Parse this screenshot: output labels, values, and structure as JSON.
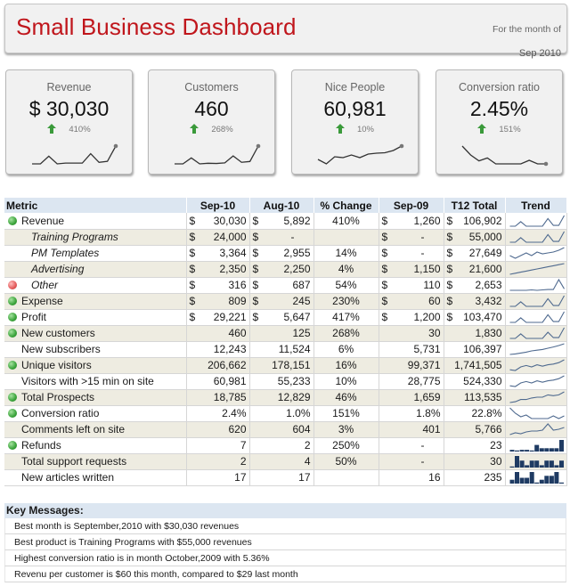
{
  "header": {
    "title": "Small Business Dashboard",
    "subtitle": "For the month of",
    "period": "Sep 2010"
  },
  "kpis": [
    {
      "label": "Revenue",
      "value": "$  30,030",
      "change": "410%",
      "direction": "up",
      "trend": [
        2,
        2,
        5,
        2,
        2.3,
        2.3,
        2.3,
        6,
        2.6,
        3,
        9
      ]
    },
    {
      "label": "Customers",
      "value": "460",
      "change": "268%",
      "direction": "up",
      "trend": [
        2,
        2,
        5,
        2,
        2.3,
        2.2,
        2.5,
        6,
        2.8,
        3.2,
        11
      ]
    },
    {
      "label": "Nice People",
      "value": "60,981",
      "change": "10%",
      "direction": "up",
      "trend": [
        3,
        2,
        3.6,
        3.4,
        4,
        3.4,
        4.2,
        4.4,
        4.5,
        5,
        6
      ]
    },
    {
      "label": "Conversion ratio",
      "value": "2.45%",
      "change": "151%",
      "direction": "up",
      "trend": [
        9,
        6,
        4,
        5,
        3,
        3,
        3,
        3,
        4.2,
        3,
        3
      ]
    }
  ],
  "table": {
    "headers": [
      "Metric",
      "Sep-10",
      "Aug-10",
      "% Change",
      "Sep-09",
      "T12 Total",
      "Trend"
    ],
    "rows": [
      {
        "metric": "Revenue",
        "indicator": "green",
        "sub": false,
        "currency": true,
        "sep10": "30,030",
        "aug10": "5,892",
        "change": "410%",
        "change_neg": false,
        "sep09": "1,260",
        "t12": "106,902",
        "trend_type": "line",
        "trend": [
          2,
          2,
          5,
          2,
          2,
          2,
          2,
          7,
          2.5,
          2.5,
          9
        ]
      },
      {
        "metric": "Training Programs",
        "indicator": "none",
        "sub": true,
        "currency": true,
        "sep10": "24,000",
        "aug10": "-",
        "change": "",
        "change_neg": false,
        "sep09": "-",
        "t12": "55,000",
        "trend_type": "line",
        "trend": [
          2,
          2,
          5,
          2,
          2,
          2,
          2,
          7,
          2.5,
          2.5,
          9
        ]
      },
      {
        "metric": "PM Templates",
        "indicator": "none",
        "sub": true,
        "currency": true,
        "sep10": "3,364",
        "aug10": "2,955",
        "change": "14%",
        "change_neg": false,
        "sep09": "-",
        "t12": "27,649",
        "trend_type": "line",
        "trend": [
          5,
          3.5,
          5,
          6.5,
          5,
          7,
          6,
          6.5,
          7,
          8,
          9.5
        ]
      },
      {
        "metric": "Advertising",
        "indicator": "none",
        "sub": true,
        "currency": true,
        "sep10": "2,350",
        "aug10": "2,250",
        "change": "4%",
        "change_neg": false,
        "sep09": "1,150",
        "t12": "21,600",
        "trend_type": "line",
        "trend": [
          3,
          3.5,
          4,
          4.5,
          5,
          5.5,
          6,
          6.5,
          7,
          7.5,
          8
        ]
      },
      {
        "metric": "Other",
        "indicator": "red",
        "sub": true,
        "currency": true,
        "sep10": "316",
        "aug10": "687",
        "change": "54%",
        "change_neg": true,
        "sep09": "110",
        "t12": "2,653",
        "trend_type": "line",
        "trend": [
          2,
          2,
          2,
          2,
          2.3,
          2,
          2.3,
          2.5,
          2.5,
          9,
          3
        ]
      },
      {
        "metric": "Expense",
        "indicator": "green",
        "sub": false,
        "currency": true,
        "sep10": "809",
        "aug10": "245",
        "change": "230%",
        "change_neg": false,
        "sep09": "60",
        "t12": "3,432",
        "trend_type": "line",
        "trend": [
          2,
          2,
          5,
          2,
          2,
          2,
          2,
          7,
          2.5,
          2.5,
          9
        ]
      },
      {
        "metric": "Profit",
        "indicator": "green",
        "sub": false,
        "currency": true,
        "sep10": "29,221",
        "aug10": "5,647",
        "change": "417%",
        "change_neg": false,
        "sep09": "1,200",
        "t12": "103,470",
        "trend_type": "line",
        "trend": [
          2,
          2,
          5,
          2,
          2,
          2,
          2,
          7,
          2.5,
          2.5,
          9
        ]
      },
      {
        "metric": "New customers",
        "indicator": "green",
        "sub": false,
        "currency": false,
        "sep10": "460",
        "aug10": "125",
        "change": "268%",
        "change_neg": false,
        "sep09": "30",
        "t12": "1,830",
        "trend_type": "line",
        "trend": [
          2,
          2,
          5,
          2,
          2,
          2,
          2,
          6,
          2.5,
          2.5,
          9
        ]
      },
      {
        "metric": "New subscribers",
        "indicator": "none",
        "sub": false,
        "currency": false,
        "sep10": "12,243",
        "aug10": "11,524",
        "change": "6%",
        "change_neg": false,
        "sep09": "5,731",
        "t12": "106,397",
        "trend_type": "line",
        "trend": [
          3,
          3.3,
          3.8,
          4.3,
          5,
          5.4,
          5.8,
          6.5,
          7.2,
          8,
          9
        ]
      },
      {
        "metric": "Unique visitors",
        "indicator": "green",
        "sub": false,
        "currency": false,
        "sep10": "206,662",
        "aug10": "178,151",
        "change": "16%",
        "change_neg": false,
        "sep09": "99,371",
        "t12": "1,741,505",
        "trend_type": "line",
        "trend": [
          3,
          2.5,
          5,
          6,
          5,
          6.5,
          5.5,
          6.5,
          7,
          8,
          10
        ]
      },
      {
        "metric": "Visitors with >15 min on site",
        "indicator": "none",
        "sub": false,
        "currency": false,
        "sep10": "60,981",
        "aug10": "55,233",
        "change": "10%",
        "change_neg": false,
        "sep09": "28,775",
        "t12": "524,330",
        "trend_type": "line",
        "trend": [
          3,
          2.5,
          5,
          6,
          5,
          6.5,
          5.5,
          6.5,
          7,
          8,
          10
        ]
      },
      {
        "metric": "Total Prospects",
        "indicator": "green",
        "sub": false,
        "currency": false,
        "sep10": "18,785",
        "aug10": "12,829",
        "change": "46%",
        "change_neg": false,
        "sep09": "1,659",
        "t12": "113,535",
        "trend_type": "line",
        "trend": [
          3,
          3.5,
          5,
          5,
          6,
          6.5,
          6.5,
          8,
          7.5,
          8,
          10
        ]
      },
      {
        "metric": "Conversion ratio",
        "indicator": "green",
        "sub": false,
        "currency": false,
        "sep10": "2.4%",
        "aug10": "1.0%",
        "change": "151%",
        "change_neg": false,
        "sep09": "1.8%",
        "t12": "22.8%",
        "trend_type": "line",
        "trend": [
          9,
          6,
          4,
          5,
          3,
          3,
          3,
          3,
          4.5,
          3,
          4.5
        ]
      },
      {
        "metric": "Comments left on site",
        "indicator": "none",
        "sub": false,
        "currency": false,
        "sep10": "620",
        "aug10": "604",
        "change": "3%",
        "change_neg": false,
        "sep09": "401",
        "t12": "5,766",
        "trend_type": "line",
        "trend": [
          3,
          4,
          3.5,
          4.5,
          5,
          5,
          5.5,
          9,
          5.5,
          6,
          7
        ]
      },
      {
        "metric": "Refunds",
        "indicator": "green",
        "sub": false,
        "currency": false,
        "sep10": "7",
        "aug10": "2",
        "change": "250%",
        "change_neg": false,
        "sep09": "-",
        "t12": "23",
        "trend_type": "bar",
        "trend": [
          1,
          0,
          1,
          1,
          0,
          4,
          2,
          2,
          2,
          2,
          7
        ]
      },
      {
        "metric": "Total support requests",
        "indicator": "none",
        "sub": false,
        "currency": false,
        "sep10": "2",
        "aug10": "4",
        "change": "50%",
        "change_neg": true,
        "sep09": "-",
        "t12": "30",
        "trend_type": "bar",
        "trend": [
          0,
          5,
          3,
          1,
          3,
          3,
          1,
          3,
          3,
          1,
          3
        ]
      },
      {
        "metric": "New articles written",
        "indicator": "none",
        "sub": false,
        "currency": false,
        "sep10": "17",
        "aug10": "17",
        "change": "",
        "change_neg": false,
        "sep09": "16",
        "t12": "235",
        "trend_type": "bar",
        "trend": [
          2,
          6,
          3,
          3,
          6,
          0,
          2,
          4,
          4,
          6,
          0
        ]
      }
    ]
  },
  "messages": {
    "title": "Key Messages:",
    "items": [
      "Best month is September,2010 with $30,030 revenues",
      "Best product is Training Programs with $55,000 revenues",
      "Highest conversion ratio is in month October,2009 with 5.36%",
      "Revenu per customer is $60 this month, compared to $29 last month"
    ]
  },
  "colors": {
    "title": "#c0161c",
    "header_bg": "#dce6f1",
    "alt_row": "#eeece1",
    "spark_line": "#4f6a8f",
    "spark_bar": "#1f3b63",
    "kpi_spark": "#333333",
    "up_arrow": "#3a9a3a",
    "negative": "#e02020"
  }
}
